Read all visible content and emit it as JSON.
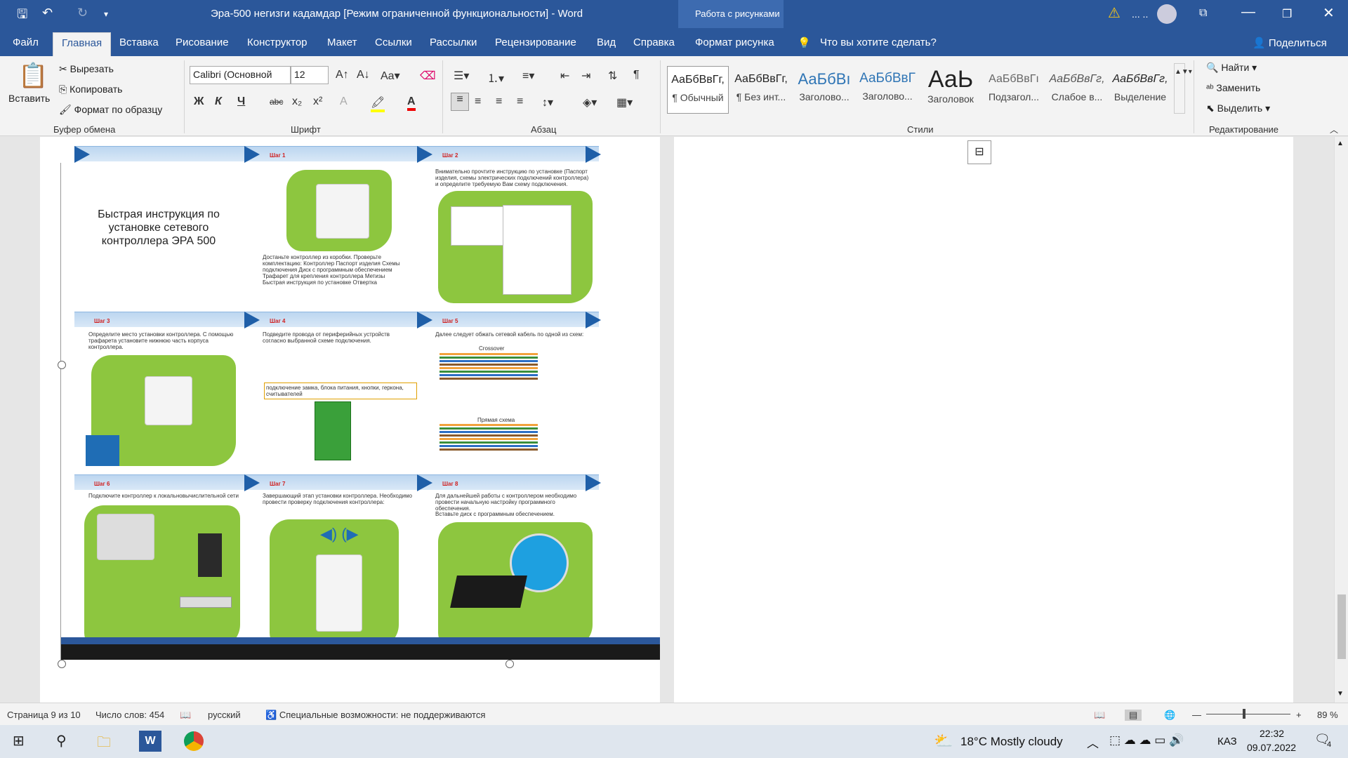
{
  "window": {
    "title": "Эра-500 негизги кадамдар [Режим ограниченной функциональности]  -  Word",
    "context_group": "Работа с рисунками"
  },
  "tabs": [
    "Файл",
    "Главная",
    "Вставка",
    "Рисование",
    "Конструктор",
    "Макет",
    "Ссылки",
    "Рассылки",
    "Рецензирование",
    "Вид",
    "Справка",
    "Формат рисунка"
  ],
  "tell_me": "Что вы хотите сделать?",
  "share": "Поделиться",
  "clipboard": {
    "paste": "Вставить",
    "cut": "Вырезать",
    "copy": "Копировать",
    "format_painter": "Формат по образцу",
    "label": "Буфер обмена"
  },
  "font": {
    "name": "Calibri (Основной",
    "size": "12",
    "label": "Шрифт",
    "bold": "Ж",
    "italic": "К",
    "underline": "Ч",
    "strike": "abc"
  },
  "paragraph": {
    "label": "Абзац"
  },
  "styles": {
    "label": "Стили",
    "items": [
      {
        "sample": "АаБбВвГг,",
        "name": "¶ Обычный"
      },
      {
        "sample": "АаБбВвГг,",
        "name": "¶ Без инт..."
      },
      {
        "sample": "АаБбВı",
        "name": "Заголово..."
      },
      {
        "sample": "АаБбВвГ",
        "name": "Заголово..."
      },
      {
        "sample": "АаЬ",
        "name": "Заголовок"
      },
      {
        "sample": "АаБбВвГı",
        "name": "Подзагол..."
      },
      {
        "sample": "АаБбВвГг,",
        "name": "Слабое в..."
      },
      {
        "sample": "АаБбВвГг,",
        "name": "Выделение"
      }
    ]
  },
  "editing": {
    "find": "Найти",
    "replace": "Заменить",
    "select": "Выделить",
    "label": "Редактирование"
  },
  "picture": {
    "heading": "Быстрая инструкция по установке сетевого контроллера ЭРА 500",
    "steps": [
      "Шаг 1",
      "Шаг 2",
      "Шаг 3",
      "Шаг 4",
      "Шаг 5",
      "Шаг 6",
      "Шаг 7",
      "Шаг 8"
    ],
    "step1_text": "Достаньте контроллер из коробки. Проверьте комплектацию: Контроллер Паспорт изделия Схемы подключения Диск с программным обеспечением Трафарет для крепления контроллера Метизы Быстрая инструкция по установке Отвертка",
    "step2_text": "Внимательно прочтите инструкцию по установке (Паспорт изделия, схемы электрических подключений контроллера) и определите требуемую Вам схему подключения.",
    "step3_text": "Определите место установки контроллера. С помощью трафарета установите нижнюю часть корпуса контроллера.",
    "step4_text": "Подведите провода от периферийных устройств согласно выбранной схеме подключения.",
    "step4_label": "подключение замка, блока питания, кнопки, геркона, считывателей",
    "step5_text": "Далее следует обжать сетевой кабель по одной из схем:",
    "crossover": "Crossover",
    "straight": "Прямая схема",
    "step6_text": "Подключите контроллер к локальновычислительной сети",
    "step7_text": "Завершающий этап установки контроллера. Необходимо провести проверку подключения контроллера:",
    "step8_text": "Для дальнейшей работы с контроллером необходимо провести начальную настройку программного обеспечения.",
    "step8_text2": "Вставьте диск с программным обеспечением."
  },
  "status": {
    "page": "Страница 9 из 10",
    "words": "Число слов: 454",
    "lang": "русский",
    "accessibility": "Специальные возможности: не поддерживаются",
    "zoom": "89 %"
  },
  "taskbar": {
    "weather": "18°C  Mostly cloudy",
    "lang": "КАЗ",
    "time": "22:32",
    "date": "09.07.2022",
    "notif": "4"
  }
}
